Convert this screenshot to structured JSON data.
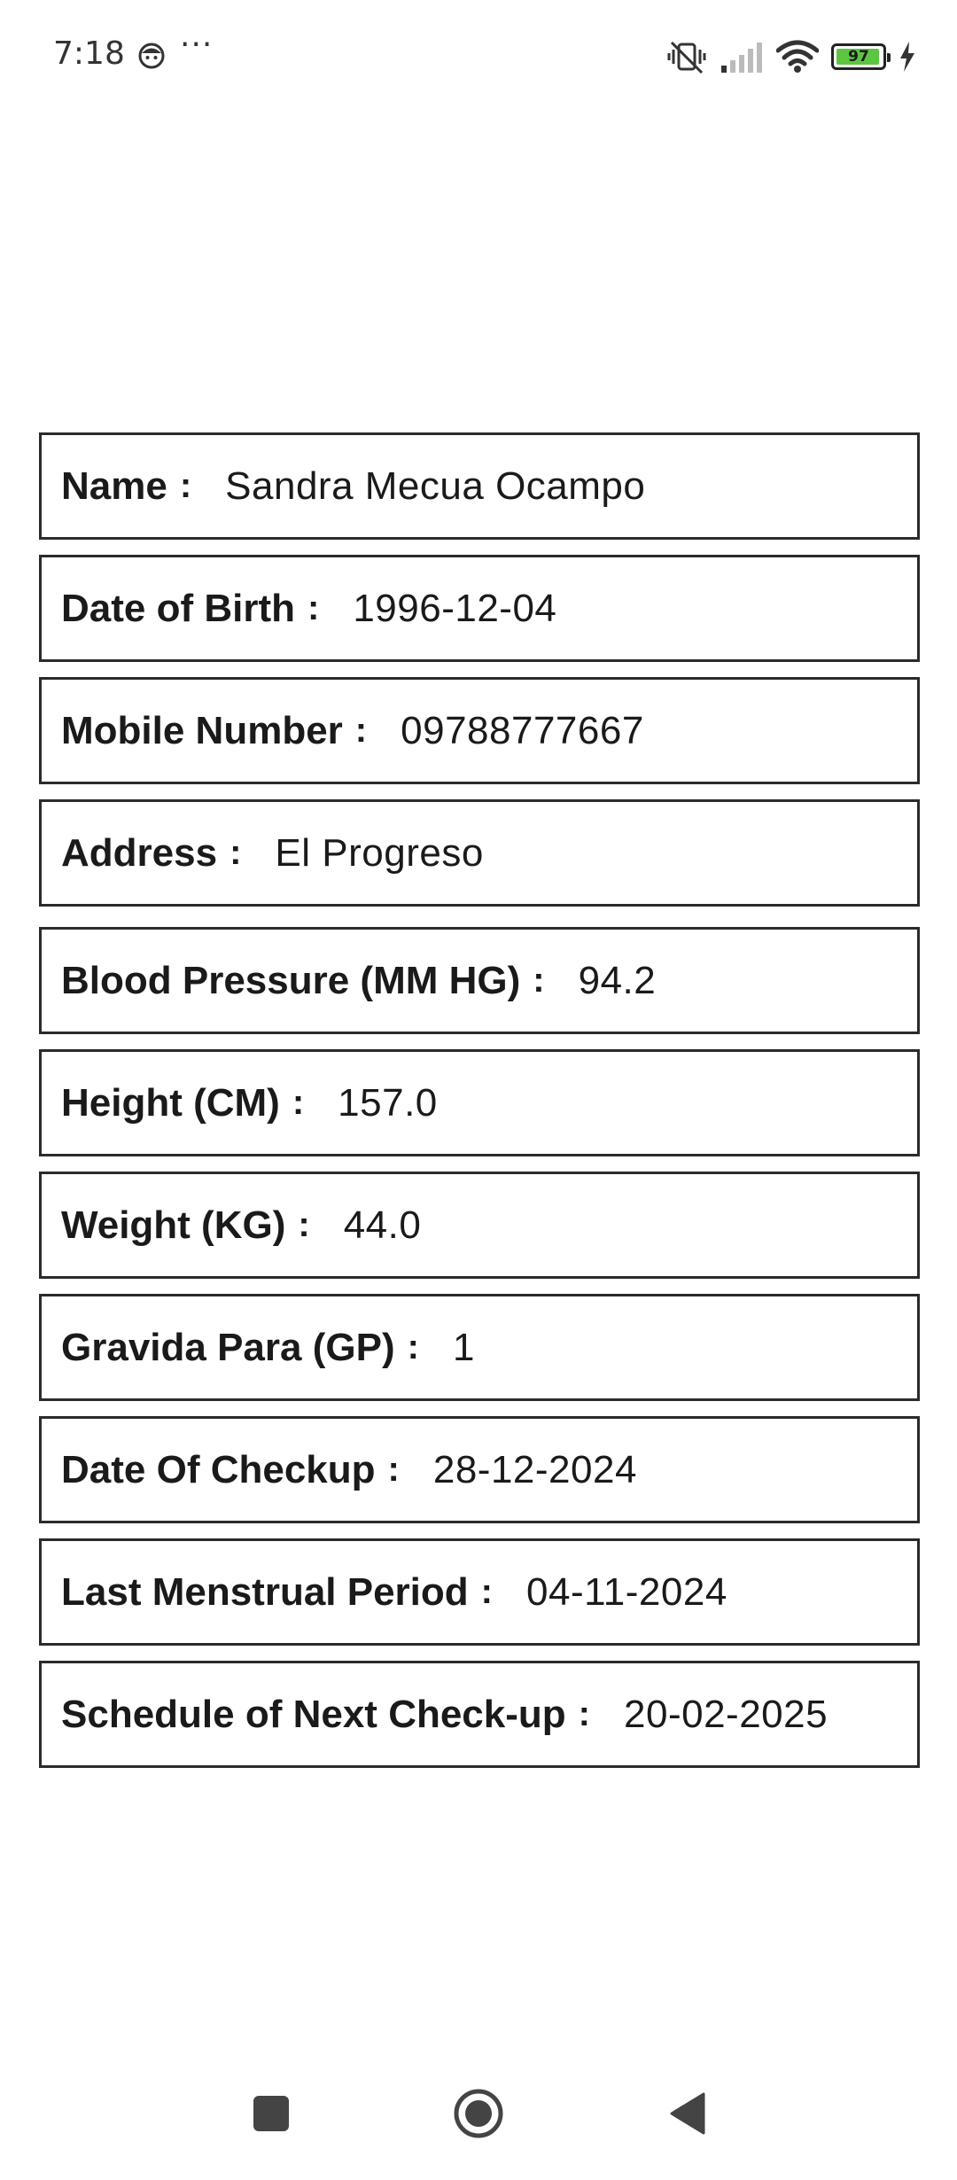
{
  "status_bar": {
    "time": "7:18",
    "more": "···",
    "battery_level": "97",
    "icons": [
      "face-icon",
      "vibrate-off-icon",
      "signal-icon",
      "wifi-icon",
      "battery-icon",
      "charging-icon"
    ],
    "battery_color": "#5cc642"
  },
  "fields": [
    {
      "label": "Name",
      "value": "Sandra Mecua Ocampo"
    },
    {
      "label": "Date of Birth",
      "value": "1996-12-04"
    },
    {
      "label": "Mobile Number",
      "value": "09788777667"
    },
    {
      "label": "Address",
      "value": "El Progreso"
    },
    {
      "label": "Blood Pressure (MM HG)",
      "value": "94.2"
    },
    {
      "label": "Height (CM)",
      "value": "157.0"
    },
    {
      "label": "Weight (KG)",
      "value": "44.0"
    },
    {
      "label": "Gravida Para (GP)",
      "value": "1"
    },
    {
      "label": "Date Of Checkup",
      "value": "28-12-2024"
    },
    {
      "label": "Last Menstrual Period",
      "value": "04-11-2024"
    },
    {
      "label": "Schedule of Next Check-up",
      "value": "20-02-2025"
    }
  ],
  "separator": ":",
  "nav_bar": {
    "icons": [
      "recents-square-icon",
      "home-circle-icon",
      "back-triangle-icon"
    ]
  }
}
